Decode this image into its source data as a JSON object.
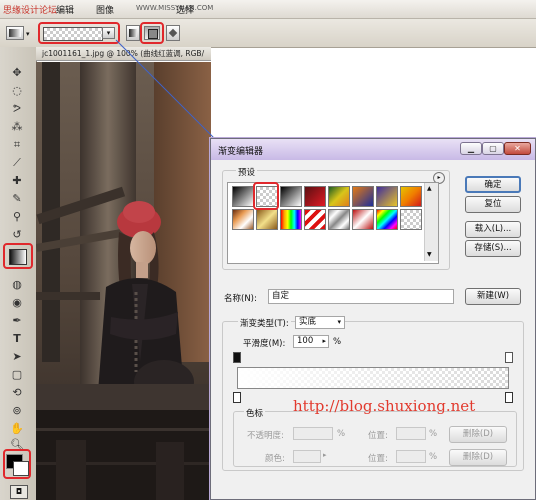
{
  "menubar": {
    "watermark": "思缘设计论坛",
    "items": [
      "编辑",
      "图像",
      "图层",
      "选择"
    ],
    "site": "WWW.MISSYUAN.COM"
  },
  "document": {
    "title": "jc1001161_1.jpg @ 100% (曲线红蓝调, RGB/"
  },
  "dialog": {
    "title": "渐变编辑器",
    "presets_label": "预设",
    "ok_label": "确定",
    "reset_label": "复位",
    "load_label": "载入(L)...",
    "save_label": "存储(S)...",
    "name_label": "名称(N):",
    "name_value": "自定",
    "new_label": "新建(W)",
    "gradient_type_label": "渐变类型(T):",
    "gradient_type_value": "实底",
    "smoothness_label": "平滑度(M):",
    "smoothness_value": "100",
    "smoothness_unit": "%",
    "stops_label": "色标",
    "opacity_label": "不透明度:",
    "opacity_unit": "%",
    "location_label": "位置:",
    "location_unit": "%",
    "delete_label": "删除(D)",
    "color_label": "颜色:",
    "location_label_2": "位置:",
    "location_unit_2": "%",
    "delete_label_2": "删除(D)",
    "watermark_url": "http://blog.shuxiong.net"
  },
  "colors": {
    "highlight_red": "#e0282c",
    "connector_blue": "#3f63c8",
    "watermark_red": "#e23a2e",
    "dialog_title": "#c8b9e6"
  }
}
